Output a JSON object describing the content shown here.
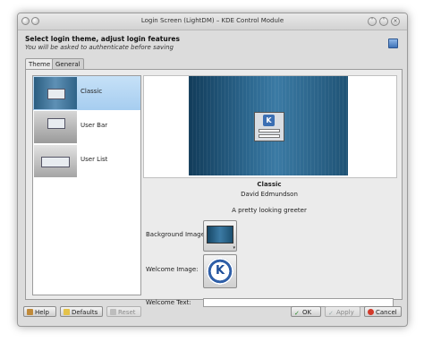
{
  "window": {
    "title": "Login Screen (LightDM) – KDE Control Module"
  },
  "header": {
    "title": "Select login theme, adjust login features",
    "subtitle": "You will be asked to authenticate before saving"
  },
  "tabs": [
    {
      "label": "Theme",
      "active": true
    },
    {
      "label": "General",
      "active": false
    }
  ],
  "themes": [
    {
      "label": "Classic",
      "selected": true
    },
    {
      "label": "User Bar",
      "selected": false
    },
    {
      "label": "User List",
      "selected": false
    }
  ],
  "details": {
    "name": "Classic",
    "author": "David Edmundson",
    "description": "A pretty looking greeter",
    "background_label": "Background Image:",
    "welcome_image_label": "Welcome Image:",
    "welcome_text_label": "Welcome Text:",
    "welcome_text_value": "",
    "preview_logo_letter": "K",
    "welcome_logo_letter": "K",
    "dropdown_arrow": "▾"
  },
  "buttons": {
    "help": "Help",
    "defaults": "Defaults",
    "reset": "Reset",
    "ok": "OK",
    "apply": "Apply",
    "cancel": "Cancel"
  },
  "icons": {
    "ok_glyph": "✓",
    "apply_glyph": "✓",
    "minimize_glyph": "˅",
    "maximize_glyph": "˄",
    "close_glyph": "×"
  },
  "colors": {
    "selection": "#a6cdf0",
    "preview_blue": "#2e6a92",
    "kde_blue": "#2f5fa8"
  }
}
